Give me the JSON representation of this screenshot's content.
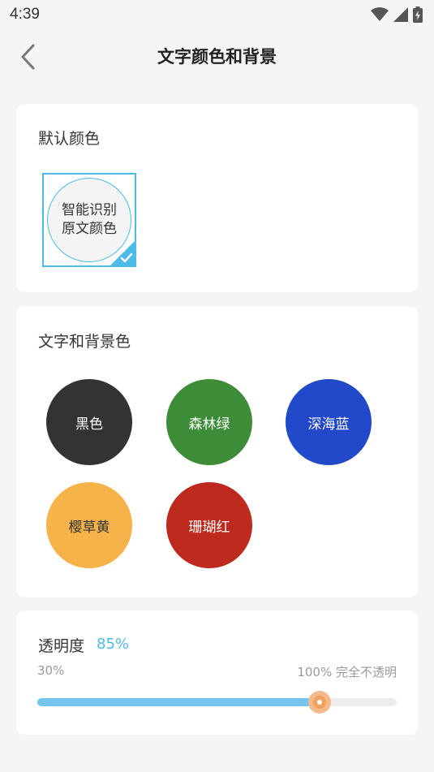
{
  "status_bar": {
    "time": "4:39",
    "icons": [
      "wifi-icon",
      "signal-icon",
      "battery-charging-icon"
    ]
  },
  "header": {
    "back_icon": "chevron-left-icon",
    "title": "文字颜色和背景"
  },
  "default_color": {
    "title": "默认颜色",
    "option_line1": "智能识别",
    "option_line2": "原文颜色",
    "selected": true,
    "accent": "#4dbbe8"
  },
  "text_bg_colors": {
    "title": "文字和背景色",
    "options": [
      {
        "label": "黑色",
        "bg": "#333333",
        "fg": "#ffffff"
      },
      {
        "label": "森林绿",
        "bg": "#3d8c37",
        "fg": "#ffffff"
      },
      {
        "label": "深海蓝",
        "bg": "#2249c9",
        "fg": "#ffffff"
      },
      {
        "label": "樱草黄",
        "bg": "#f5b349",
        "fg": "#333333"
      },
      {
        "label": "珊瑚红",
        "bg": "#bf2a1f",
        "fg": "#ffffff"
      }
    ]
  },
  "opacity": {
    "title": "透明度",
    "value_label": "85%",
    "min_label": "30%",
    "max_label": "100% 完全不透明",
    "value": 85,
    "min": 30,
    "max": 100,
    "fill_color": "#74c4ee",
    "thumb_color": "#f2a25e"
  }
}
